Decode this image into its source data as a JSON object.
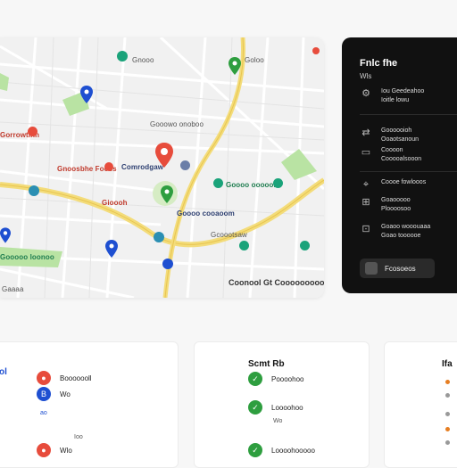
{
  "colors": {
    "accent_red": "#e74c3c",
    "accent_green": "#2ecc71",
    "accent_blue": "#1e4fd1",
    "panel_bg": "#111111",
    "road": "#f3dc7a",
    "park": "#b9e3a3"
  },
  "map": {
    "labels": [
      {
        "text": "Gorrowtinn",
        "cls": "red"
      },
      {
        "text": "Comrodgaw",
        "cls": "blue"
      },
      {
        "text": "Gooowo onoboo",
        "cls": ""
      },
      {
        "text": "Gnoosbhe Fooss",
        "cls": "red"
      },
      {
        "text": "Goooo ooooon",
        "cls": "green"
      },
      {
        "text": "Goooo cooaoom",
        "cls": "blue"
      },
      {
        "text": "Gooooo loonoo",
        "cls": "green"
      },
      {
        "text": "Gioooh",
        "cls": "red"
      },
      {
        "text": "Gnooo",
        "cls": ""
      },
      {
        "text": "Goloo",
        "cls": ""
      },
      {
        "text": "Gcoootsaw",
        "cls": ""
      },
      {
        "text": "Gaaaa",
        "cls": ""
      }
    ],
    "attribution": "Coonool Gt Cooooooooo"
  },
  "panel": {
    "title": "Fnlc fhe",
    "subtitle": "Wls",
    "items": [
      {
        "icon": "gear-icon",
        "glyph": "⚙",
        "lines": [
          "Iou Geedeahoo",
          "Ioitle lowu"
        ]
      },
      {
        "icon": "share-icon",
        "glyph": "⇄",
        "lines": [
          "Goooooioh",
          "Ooaotsanoun"
        ]
      },
      {
        "icon": "layers-icon",
        "glyph": "▭",
        "lines": [
          "Coooon",
          "Cooooalsooon"
        ]
      },
      {
        "icon": "pin-icon",
        "glyph": "⌖",
        "lines": [
          "Coooe fowlooos"
        ]
      },
      {
        "icon": "grid-icon",
        "glyph": "⊞",
        "lines": [
          "Goaooooo",
          "Ploooosoo"
        ]
      },
      {
        "icon": "route-icon",
        "glyph": "⊡",
        "lines": [
          "Goaoo wooouaaa",
          "Goao toooooe"
        ]
      }
    ],
    "button": "Fcosoeos"
  },
  "cards": [
    {
      "title": "",
      "items": [
        {
          "glyph": "●",
          "color": "#e74c3c",
          "text": "Booooooll"
        },
        {
          "glyph": "B",
          "color": "#1e4fd1",
          "text": "Wo"
        },
        {
          "glyph": "",
          "color": "",
          "text": "ao"
        },
        {
          "glyph": "",
          "color": "",
          "text": "Ioo"
        },
        {
          "glyph": "●",
          "color": "#e74c3c",
          "text": "Wlo"
        }
      ],
      "side": "ol"
    },
    {
      "title": "Scmt Rb",
      "items": [
        {
          "glyph": "✓",
          "color": "#2e9e3f",
          "text": "Poooohoo"
        },
        {
          "glyph": "✓",
          "color": "#2e9e3f",
          "text": "Loooohoo"
        },
        {
          "glyph": "",
          "color": "",
          "text": "Wo"
        },
        {
          "glyph": "✓",
          "color": "#2e9e3f",
          "text": "Loooohooooo"
        }
      ]
    },
    {
      "title": "Ifa",
      "items": []
    }
  ]
}
